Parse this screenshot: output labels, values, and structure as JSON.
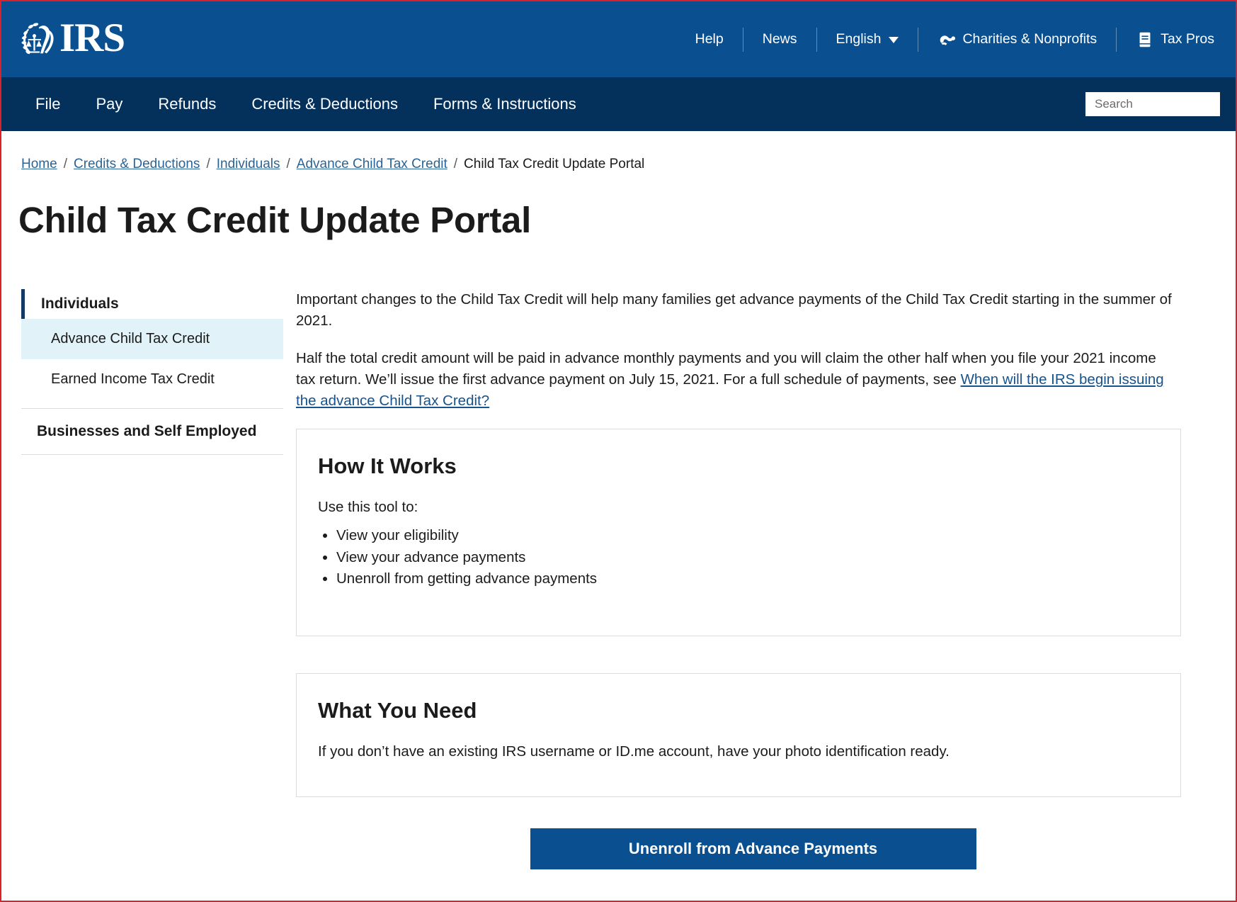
{
  "header": {
    "logo_alt": "IRS",
    "logo_text": "IRS",
    "utility_nav": [
      {
        "label": "Help",
        "icon": null
      },
      {
        "label": "News",
        "icon": null
      },
      {
        "label": "English",
        "icon": "chevron-down-icon"
      },
      {
        "label": "Charities & Nonprofits",
        "icon": "handshake-icon"
      },
      {
        "label": "Tax Pros",
        "icon": "book-icon"
      }
    ]
  },
  "main_nav": {
    "items": [
      {
        "label": "File"
      },
      {
        "label": "Pay"
      },
      {
        "label": "Refunds"
      },
      {
        "label": "Credits & Deductions"
      },
      {
        "label": "Forms & Instructions"
      }
    ],
    "search": {
      "placeholder": "Search",
      "value": "",
      "button_icon": "search-icon"
    }
  },
  "breadcrumb": {
    "items": [
      {
        "label": "Home",
        "current": false
      },
      {
        "label": "Credits & Deductions",
        "current": false
      },
      {
        "label": "Individuals",
        "current": false
      },
      {
        "label": "Advance Child Tax Credit",
        "current": false
      },
      {
        "label": "Child Tax Credit Update Portal",
        "current": true
      }
    ],
    "separator": "/"
  },
  "page": {
    "title": "Child Tax Credit Update Portal"
  },
  "sidebar": {
    "groups": [
      {
        "title": "Individuals",
        "items": [
          {
            "label": "Advance Child Tax Credit",
            "active": true
          },
          {
            "label": "Earned Income Tax Credit",
            "active": false
          }
        ]
      },
      {
        "title": "Businesses and Self Employed",
        "items": []
      }
    ]
  },
  "main": {
    "paragraph_1": "Important changes to the Child Tax Credit will help many families get advance payments of the Child Tax Credit starting in the summer of 2021.",
    "paragraph_2_part1": "Half the total credit amount will be paid in advance monthly payments and you will claim the other half when you file your 2021 income tax return. We’ll issue the first advance payment on July 15, 2021. For a full schedule of payments, see ",
    "paragraph_2_link": "When will the IRS begin issuing the advance Child Tax Credit?",
    "cards": [
      {
        "title": "How It Works",
        "intro": "Use this tool to:",
        "list": [
          "View your eligibility",
          "View your advance payments",
          "Unenroll from getting advance payments"
        ]
      },
      {
        "title": "What You Need",
        "intro": "If you don’t have an existing IRS username or ID.me account, have your photo identification ready.",
        "list": []
      }
    ],
    "cta_button": "Unenroll from Advance Payments"
  },
  "colors": {
    "header_blue": "#0a5091",
    "nav_navy": "#04305c",
    "link_blue": "#17538c",
    "active_sidebar": "#e1f3f8",
    "page_border_red": "#d8232a",
    "cta_blue": "#0a5091"
  }
}
